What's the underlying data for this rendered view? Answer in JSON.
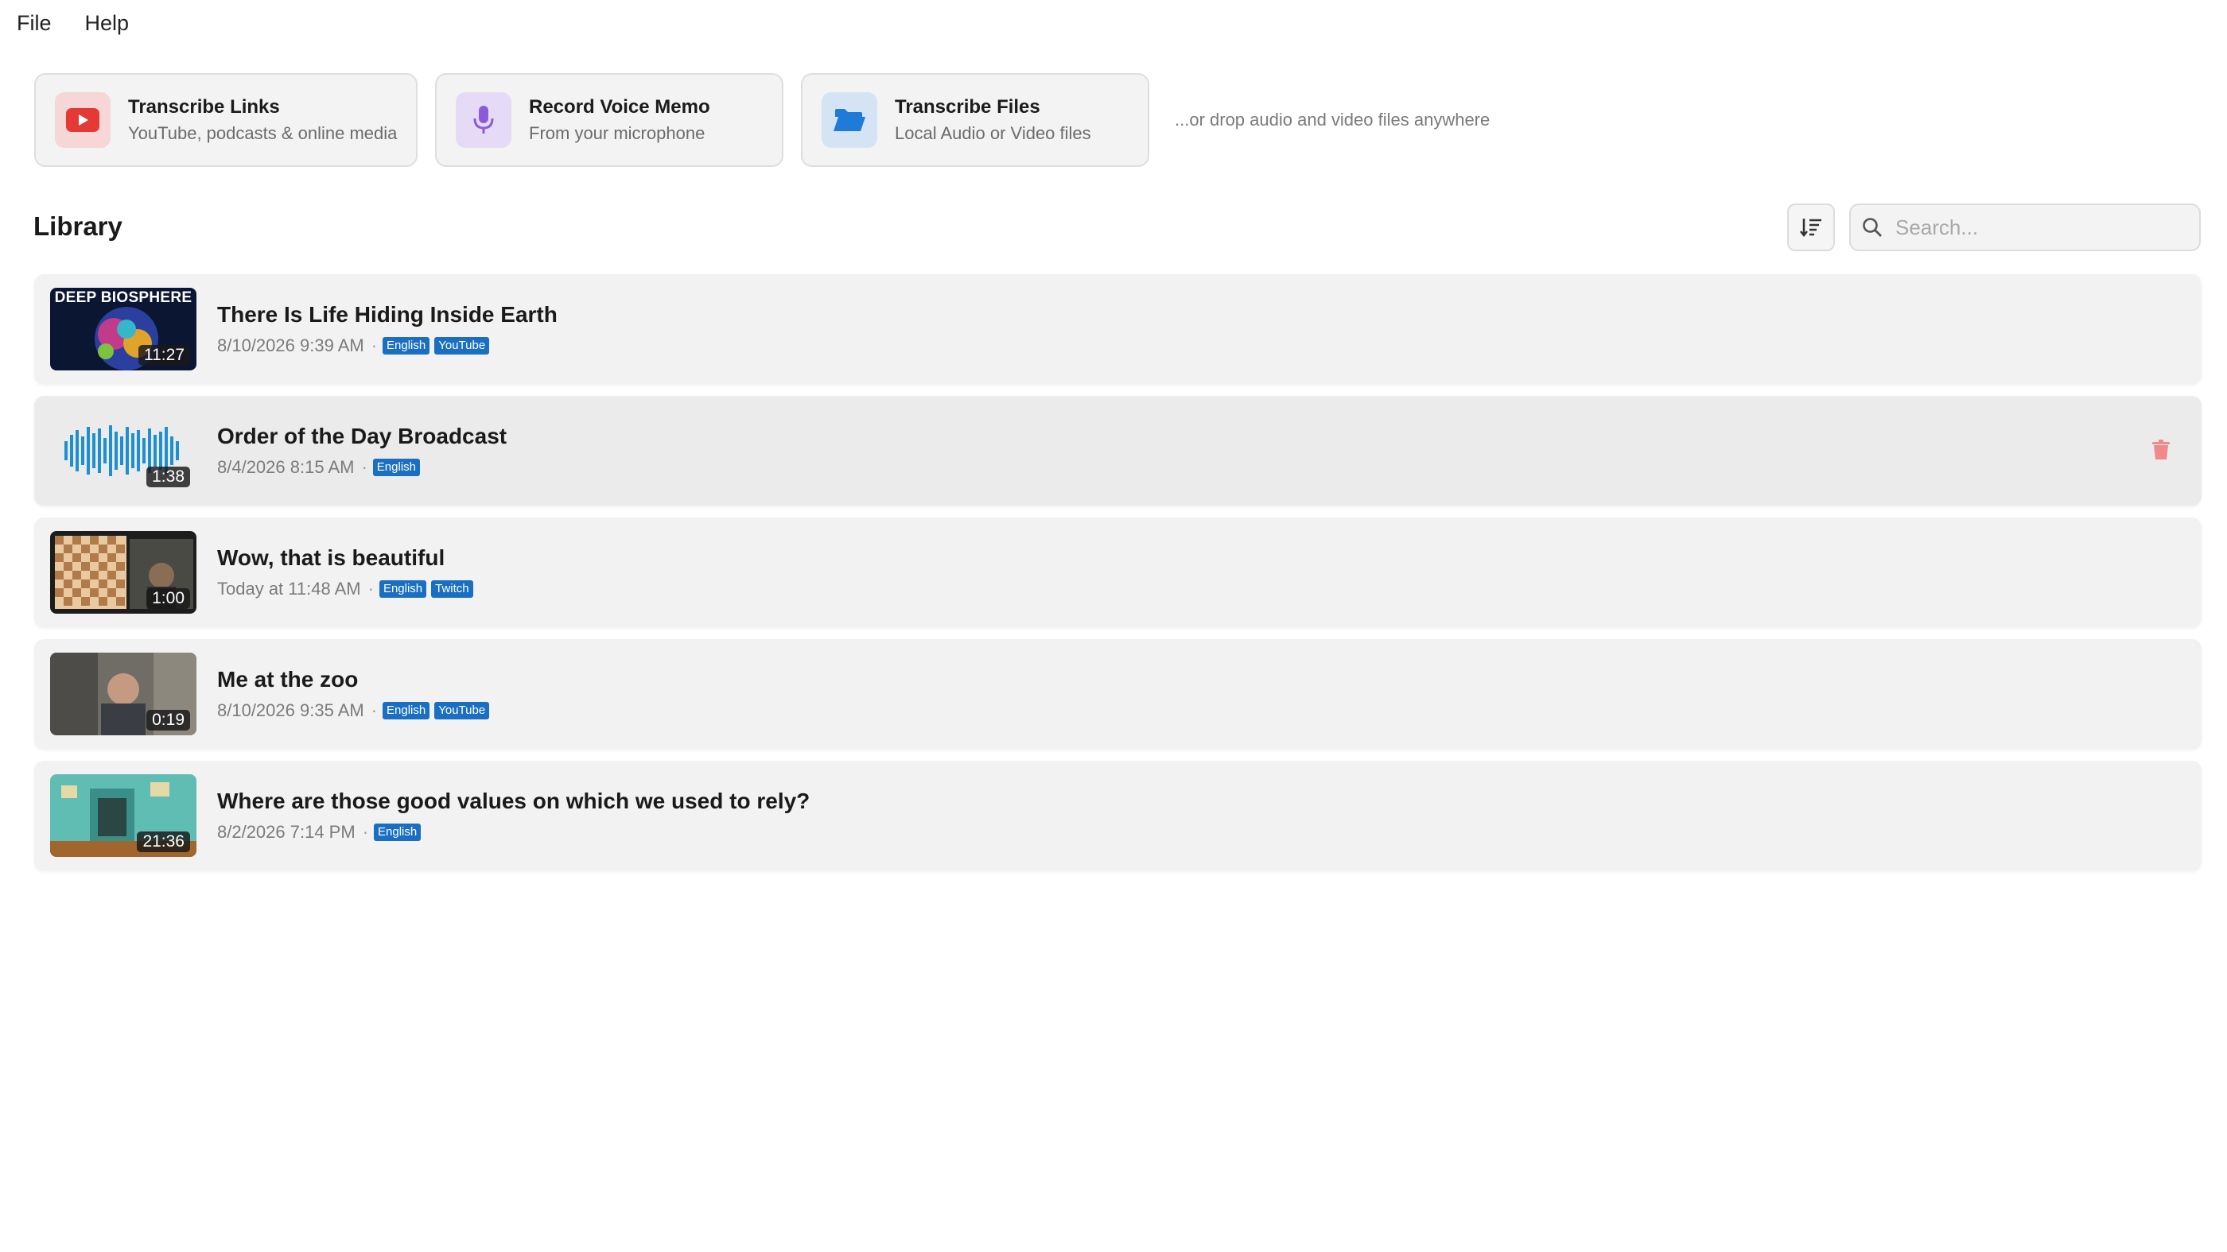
{
  "menu": {
    "file": "File",
    "help": "Help"
  },
  "actions": [
    {
      "title": "Transcribe Links",
      "subtitle": "YouTube, podcasts & online media",
      "icon": "youtube-icon"
    },
    {
      "title": "Record Voice Memo",
      "subtitle": "From your microphone",
      "icon": "microphone-icon"
    },
    {
      "title": "Transcribe Files",
      "subtitle": "Local Audio or Video files",
      "icon": "folder-icon"
    }
  ],
  "drop_hint": "...or drop audio and video files anywhere",
  "library": {
    "title": "Library",
    "sort_icon": "sort-icon",
    "search": {
      "placeholder": "Search...",
      "value": "",
      "icon": "search-icon"
    },
    "items": [
      {
        "title": "There Is Life Hiding Inside Earth",
        "date": "8/10/2026 9:39 AM",
        "duration": "11:27",
        "tags": [
          "English",
          "YouTube"
        ],
        "thumb_caption": "DEEP BIOSPHERE"
      },
      {
        "title": "Order of the Day Broadcast",
        "date": "8/4/2026 8:15 AM",
        "duration": "1:38",
        "tags": [
          "English"
        ],
        "delete_icon": "trash-icon"
      },
      {
        "title": "Wow, that is beautiful",
        "date": "Today at 11:48 AM",
        "duration": "1:00",
        "tags": [
          "English",
          "Twitch"
        ]
      },
      {
        "title": "Me at the zoo",
        "date": "8/10/2026 9:35 AM",
        "duration": "0:19",
        "tags": [
          "English",
          "YouTube"
        ]
      },
      {
        "title": "Where are those good values on which we used to rely?",
        "date": "8/2/2026 7:14 PM",
        "duration": "21:36",
        "tags": [
          "English"
        ]
      }
    ]
  },
  "colors": {
    "accent_tag": "#1a6fc2",
    "youtube_red": "#e53935",
    "mic_purple": "#8e5bd6",
    "folder_blue": "#1f7bd8"
  }
}
